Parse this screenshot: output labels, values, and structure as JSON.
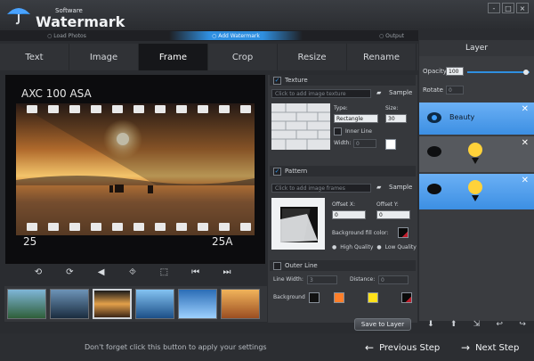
{
  "app": {
    "brand_small": "Software",
    "brand_big": "Watermark",
    "window_controls": [
      "-",
      "□",
      "×"
    ]
  },
  "progress": {
    "steps": [
      {
        "label": "○ Load Photos"
      },
      {
        "label": "○ Add Watermark",
        "active": true
      },
      {
        "label": "○ Output"
      }
    ]
  },
  "tabs": [
    {
      "label": "Text"
    },
    {
      "label": "Image"
    },
    {
      "label": "Frame",
      "active": true
    },
    {
      "label": "Crop"
    },
    {
      "label": "Resize"
    },
    {
      "label": "Rename"
    }
  ],
  "photo": {
    "top_text": "AXC 100 ASA",
    "left_bottom": "25",
    "right_bottom": "25A"
  },
  "controls": [
    "⟲",
    "⟳",
    "◀",
    "⯑",
    "⬚",
    "⏮",
    "⏭"
  ],
  "right": {
    "texture": {
      "header": "Texture",
      "hint": "Click to add image texture",
      "sample": "Sample",
      "type_label": "Type:",
      "size_label": "Size:",
      "type_value": "Rectangle",
      "size_value": "30",
      "inner_line": "Inner Line",
      "width_label": "Width:",
      "width_value": "0"
    },
    "pattern": {
      "header": "Pattern",
      "hint": "Click to add image frames",
      "sample": "Sample",
      "offsetx_label": "Offset X:",
      "offsety_label": "Offset Y:",
      "offsetx_value": "0",
      "offsety_value": "0",
      "fill_color_label": "Background fill color:",
      "high_quality": "High Quality",
      "low_quality": "Low Quality"
    },
    "outer": {
      "header": "Outer Line",
      "line_width_label": "Line Width:",
      "line_width_value": "3",
      "distance_label": "Distance:",
      "distance_value": "0",
      "background_label": "Background"
    },
    "save_label": "Save to Layer"
  },
  "layer": {
    "title": "Layer",
    "opacity_label": "Opacity",
    "opacity_value": "100",
    "rotate_label": "Rotate",
    "rotate_value": "0",
    "items": [
      {
        "name": "Beauty",
        "state": "selected"
      },
      {
        "name": "",
        "state": "normal"
      },
      {
        "name": "",
        "state": "selected"
      }
    ],
    "tools": [
      "⬇",
      "⬆",
      "⇲",
      "↩",
      "↪"
    ]
  },
  "footer": {
    "hint": "Don't forget click this button to apply your settings",
    "prev": "Previous Step",
    "next": "Next Step"
  },
  "colors": {
    "accent": "#2f8fe0",
    "panel": "#36383c",
    "background": "#2a2c30"
  }
}
